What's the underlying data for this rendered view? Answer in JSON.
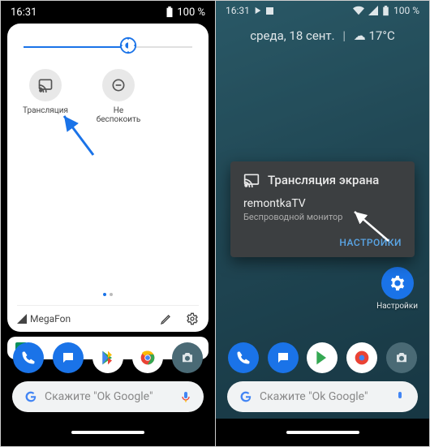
{
  "left": {
    "statusbar": {
      "time": "16:31",
      "battery": "100 %"
    },
    "slider": {
      "value_pct": 62
    },
    "tiles": [
      {
        "name": "cast",
        "label": "Трансляция"
      },
      {
        "name": "dnd",
        "label": "Не беспокоить"
      }
    ],
    "carrier": "MegaFon",
    "search_hint": "Скажите \"Ok Google\""
  },
  "right": {
    "statusbar": {
      "time": "16:31",
      "battery": "100 %"
    },
    "weather": {
      "date": "среда, 18 сент.",
      "sep": "|",
      "icon": "cloud",
      "temp": "17°C"
    },
    "dialog": {
      "title": "Трансляция экрана",
      "device": "remontkaTV",
      "subtitle": "Беспроводной монитор",
      "settings": "НАСТРОЙКИ"
    },
    "settings_shortcut": "Настройки",
    "search_hint": "Скажите \"Ok Google\""
  }
}
